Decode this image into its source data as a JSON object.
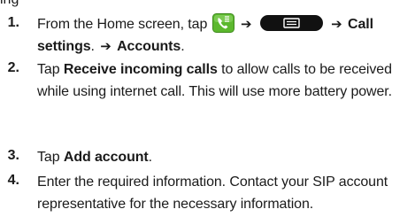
{
  "doc": {
    "cut_text": "ing",
    "steps": [
      {
        "number": "1.",
        "parts": {
          "p1": "From the Home screen, tap",
          "arrow1": "➔",
          "arrow2": "➔",
          "call_settings": "Call settings",
          "dot": ".",
          "arrow3": "➔",
          "accounts": "Accounts",
          "end": "."
        },
        "icons": [
          "phone-icon",
          "menu-key-icon"
        ]
      },
      {
        "number": "2.",
        "parts": {
          "p1": "Tap",
          "bold": "Receive incoming calls",
          "p2": "to allow calls to be received while using internet call. This will use more battery power."
        }
      },
      {
        "number": "3.",
        "parts": {
          "p1": "Tap",
          "bold": "Add account",
          "end": "."
        }
      },
      {
        "number": "4.",
        "parts": {
          "p1": "Enter the required information. Contact your SIP account representative for the necessary information."
        }
      }
    ],
    "colors": {
      "phone_icon_bg": "#5cb82e",
      "menu_key_bg": "#111111"
    }
  }
}
